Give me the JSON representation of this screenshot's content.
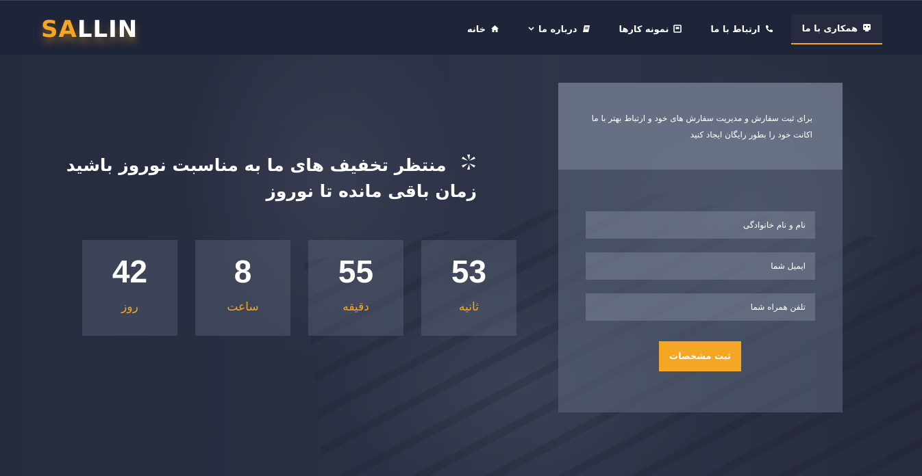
{
  "brand": {
    "logo_accent": "SA",
    "logo_rest": "LLIN",
    "accent_color": "#f5a623"
  },
  "nav": {
    "items": [
      {
        "label": "همکاری با ما",
        "icon": "handshake-icon",
        "active": true
      },
      {
        "label": "ارتباط با ما",
        "icon": "phone-icon"
      },
      {
        "label": "نمونه کارها",
        "icon": "portfolio-icon"
      },
      {
        "label": "درباره ما",
        "icon": "book-icon",
        "dropdown": true
      },
      {
        "label": "خانه",
        "icon": "home-icon"
      }
    ]
  },
  "hero": {
    "headline_line1": "منتظر تخفیف های ما به مناسبت نوروز باشید",
    "headline_line2": "زمان باقی مانده تا نوروز",
    "headline_icon": "sparkle-icon"
  },
  "countdown": [
    {
      "value": "42",
      "label": "روز"
    },
    {
      "value": "8",
      "label": "ساعت"
    },
    {
      "value": "55",
      "label": "دقیقه"
    },
    {
      "value": "53",
      "label": "ثانیه"
    }
  ],
  "register": {
    "intro": "برای ثبت سفارش و مدیریت سفارش های خود و ارتباط بهتر با ما اکانت خود را بطور رایگان ایجاد کنید",
    "name_placeholder": "نام و نام خانوادگی",
    "email_placeholder": "ایمیل شما",
    "phone_placeholder": "تلفن همراه شما",
    "submit_label": "ثبت مشخصات"
  }
}
